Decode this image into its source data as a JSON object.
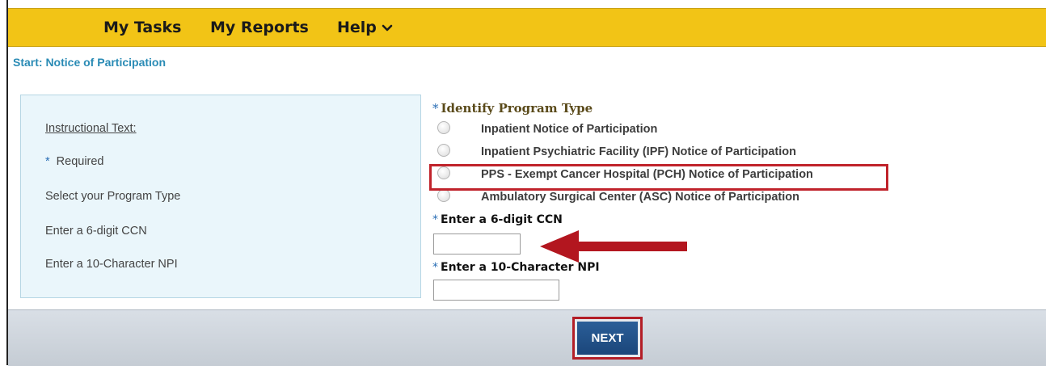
{
  "nav": {
    "items": [
      {
        "label": "My Tasks"
      },
      {
        "label": "My Reports"
      },
      {
        "label": "Help"
      }
    ]
  },
  "breadcrumb": "Start: Notice of Participation",
  "instructions": {
    "title": "Instructional Text:",
    "required_star": "*",
    "required": "Required",
    "program": "Select your Program Type",
    "ccn": "Enter a 6-digit CCN",
    "npi": "Enter a 10-Character NPI"
  },
  "form": {
    "program_star": "*",
    "program_title": "Identify Program Type",
    "options": [
      {
        "label": "Inpatient Notice of Participation"
      },
      {
        "label": "Inpatient Psychiatric Facility (IPF) Notice of Participation"
      },
      {
        "label": "PPS - Exempt Cancer Hospital (PCH) Notice of Participation"
      },
      {
        "label": "Ambulatory Surgical Center (ASC) Notice of Participation"
      }
    ],
    "ccn_star": "*",
    "ccn_label": "Enter a 6-digit CCN",
    "ccn_value": "",
    "npi_star": "*",
    "npi_label": "Enter a 10-Character NPI",
    "npi_value": ""
  },
  "footer": {
    "next_label": "NEXT"
  },
  "colors": {
    "nav_bg": "#f2c416",
    "accent_blue": "#2a8bb5",
    "highlight_red": "#c0232b",
    "button_blue": "#1f4f87"
  }
}
